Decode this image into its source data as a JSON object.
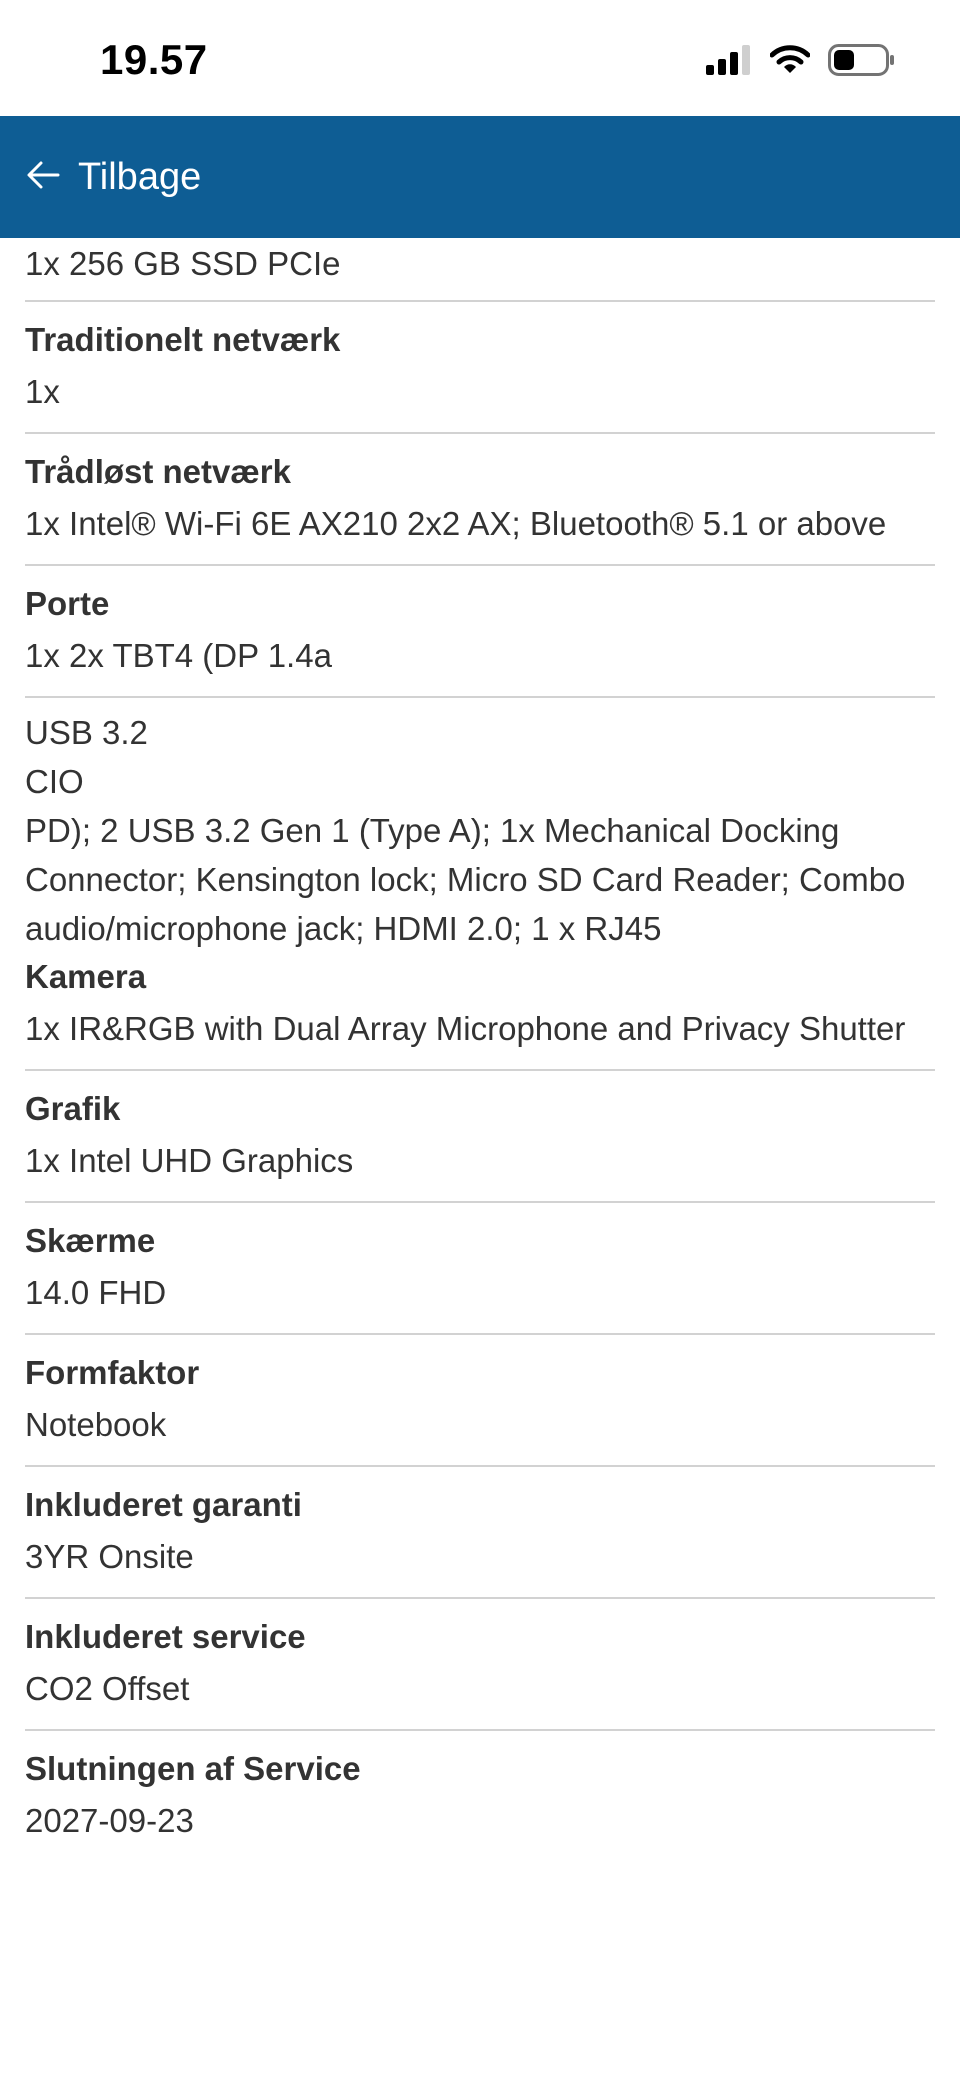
{
  "status_bar": {
    "time": "19.57"
  },
  "header": {
    "back_label": "Tilbage"
  },
  "first_value": "1x 256 GB SSD PCIe",
  "rows_a": [
    {
      "label": "Traditionelt netværk",
      "value": "1x"
    },
    {
      "label": "Trådløst netværk",
      "value": "1x Intel® Wi-Fi 6E AX210 2x2 AX; Bluetooth® 5.1 or above"
    },
    {
      "label": "Porte",
      "value": "1x 2x TBT4 (DP 1.4a"
    }
  ],
  "ports_continuation": {
    "line1": "USB 3.2",
    "line2": "CIO",
    "line3": "PD); 2 USB 3.2 Gen 1 (Type A); 1x Mechanical Docking Connector; Kensington lock; Micro SD Card Reader; Combo audio/microphone jack; HDMI 2.0; 1 x RJ45"
  },
  "rows_b": [
    {
      "label": "Kamera",
      "value": "1x IR&RGB with Dual Array Microphone and Privacy Shutter"
    },
    {
      "label": "Grafik",
      "value": "1x Intel UHD Graphics"
    },
    {
      "label": "Skærme",
      "value": "14.0 FHD"
    },
    {
      "label": "Formfaktor",
      "value": "Notebook"
    },
    {
      "label": "Inkluderet garanti",
      "value": "3YR Onsite"
    },
    {
      "label": "Inkluderet service",
      "value": "CO2 Offset"
    },
    {
      "label": "Slutningen af Service",
      "value": "2027-09-23"
    }
  ]
}
